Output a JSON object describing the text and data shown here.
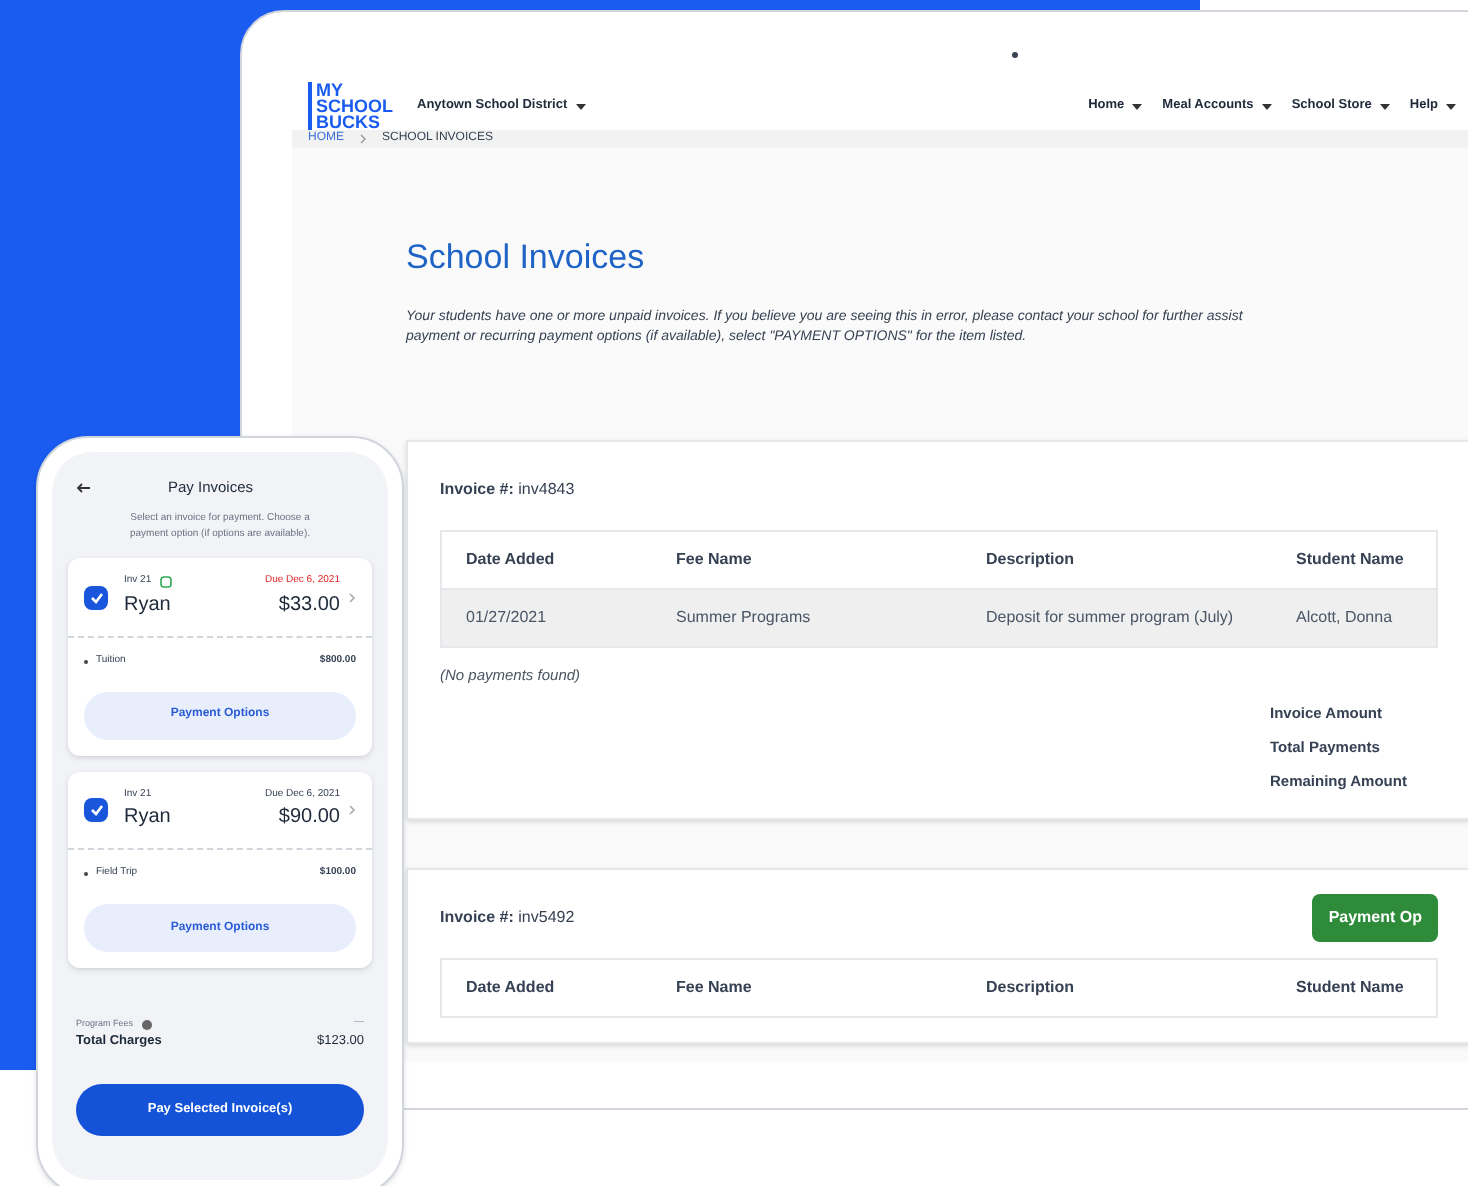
{
  "site": {
    "logo": [
      "MY",
      "SCHOOL",
      "BUCKS"
    ],
    "district": "Anytown School District",
    "nav": [
      "Home",
      "Meal Accounts",
      "School Store",
      "Help"
    ]
  },
  "breadcrumb": [
    "HOME",
    "SCHOOL INVOICES"
  ],
  "page": {
    "title": "School Invoices",
    "intro": [
      "Your students have one or more unpaid invoices. If you believe you are seeing this in error, please contact your school for further assist",
      "payment or recurring payment options (if available), select \"PAYMENT OPTIONS\" for the item listed."
    ]
  },
  "invoices": [
    {
      "label": "Invoice #:",
      "number": "inv4843",
      "columns": [
        "Date Added",
        "Fee Name",
        "Description",
        "Student Name"
      ],
      "rows": [
        [
          "01/27/2021",
          "Summer Programs",
          "Deposit for summer program (July)",
          "Alcott, Donna"
        ]
      ],
      "note": "(No payments found)",
      "summary": [
        "Invoice Amount",
        "Total Payments",
        "Remaining Amount"
      ]
    },
    {
      "label": "Invoice #:",
      "number": "inv5492",
      "button": "Payment Op",
      "columns": [
        "Date Added",
        "Fee Name",
        "Description",
        "Student Name"
      ]
    }
  ],
  "phone": {
    "title": "Pay Invoices",
    "subtitle": "Select an invoice for payment. Choose a payment option (if options are available).",
    "cards": [
      {
        "invoice": "Inv 21",
        "badge": true,
        "name": "Ryan",
        "due": "Due Dec 6, 2021",
        "overdue": true,
        "amount": "$33.00",
        "checked": true,
        "item": "Tuition",
        "item_amount": "$800.00",
        "button": "Payment Options"
      },
      {
        "invoice": "Inv 21",
        "badge": false,
        "name": "Ryan",
        "due": "Due Dec 6, 2021",
        "overdue": false,
        "amount": "$90.00",
        "checked": true,
        "item": "Field Trip",
        "item_amount": "$100.00",
        "button": "Payment Options"
      }
    ],
    "fees_label": "Program Fees",
    "fees_value": "—",
    "total_label": "Total Charges",
    "total": "$123.00",
    "pay_button": "Pay Selected Invoice(s)"
  }
}
